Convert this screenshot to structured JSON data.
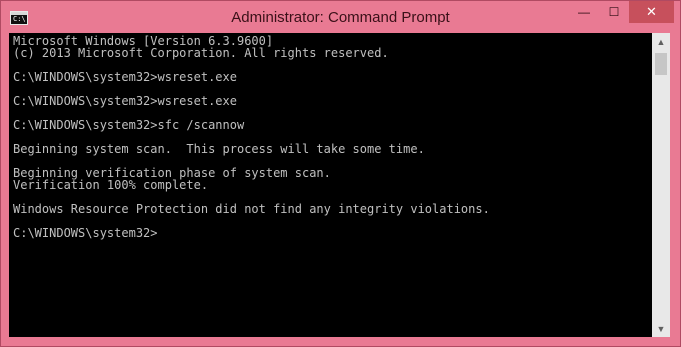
{
  "window": {
    "title": "Administrator: Command Prompt",
    "icon_glyph": "C:\\",
    "controls": {
      "minimize_icon": "minimize-icon",
      "maximize_icon": "maximize-icon",
      "close_icon": "close-icon",
      "minimize_glyph": "—",
      "maximize_glyph": "☐",
      "close_glyph": "✕"
    },
    "colors": {
      "frame": "#e97a93",
      "console_bg": "#000000",
      "console_text": "#c0c0c0",
      "close_button": "#c7505c"
    }
  },
  "console": {
    "lines": [
      "Microsoft Windows [Version 6.3.9600]",
      "(c) 2013 Microsoft Corporation. All rights reserved.",
      "C:\\WINDOWS\\system32>wsreset.exe",
      "C:\\WINDOWS\\system32>wsreset.exe",
      "C:\\WINDOWS\\system32>sfc /scannow",
      "Beginning system scan.  This process will take some time.",
      "Beginning verification phase of system scan.",
      "Verification 100% complete.",
      "Windows Resource Protection did not find any integrity violations.",
      "C:\\WINDOWS\\system32>"
    ]
  },
  "scrollbar": {
    "up_glyph": "▲",
    "down_glyph": "▼"
  }
}
